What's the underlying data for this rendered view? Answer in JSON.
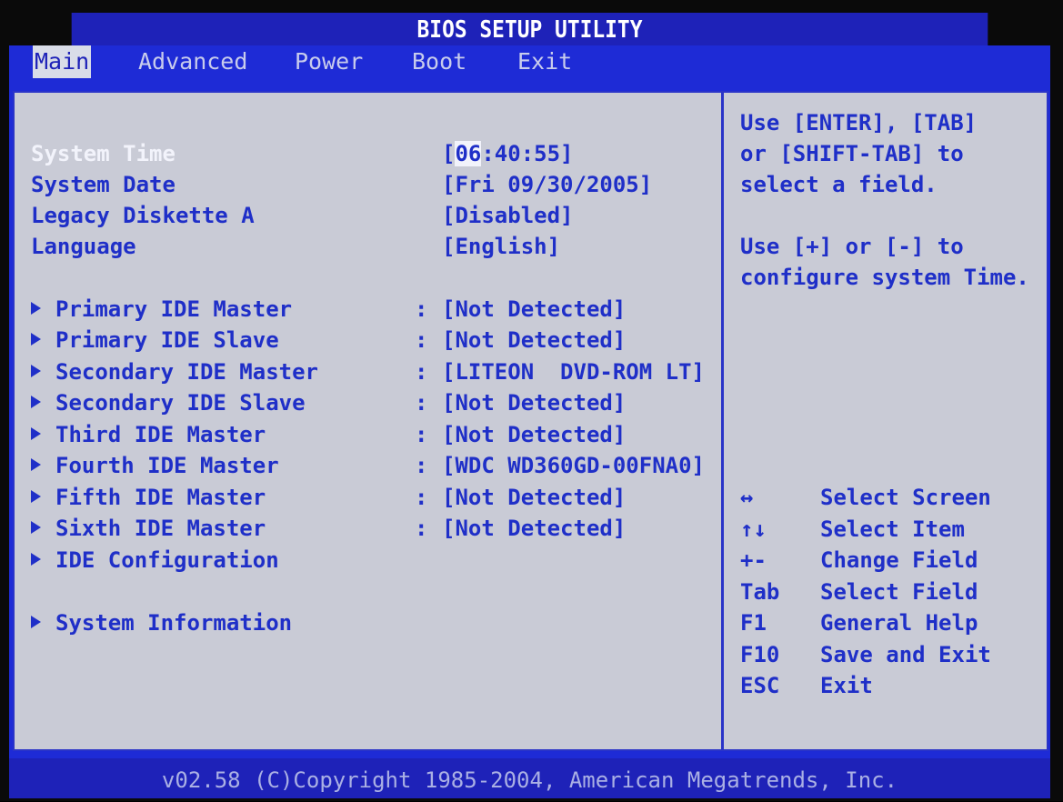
{
  "window": {
    "title": "BIOS SETUP UTILITY"
  },
  "menu": [
    {
      "label": "Main",
      "active": true
    },
    {
      "label": "Advanced",
      "active": false
    },
    {
      "label": "Power",
      "active": false
    },
    {
      "label": "Boot",
      "active": false
    },
    {
      "label": "Exit",
      "active": false
    }
  ],
  "settings": {
    "system_time": {
      "label": "System Time",
      "value_prefix": "[",
      "value_cursor": "06",
      "value_rest": ":40:55]"
    },
    "system_date": {
      "label": "System Date",
      "value": "[Fri 09/30/2005]"
    },
    "legacy_diskette": {
      "label": "Legacy Diskette A",
      "value": "[Disabled]"
    },
    "language": {
      "label": "Language",
      "value": "[English]"
    }
  },
  "devices": [
    {
      "label": "Primary IDE Master",
      "value": "[Not Detected]"
    },
    {
      "label": "Primary IDE Slave",
      "value": "[Not Detected]"
    },
    {
      "label": "Secondary IDE Master",
      "value": "[LITEON  DVD-ROM LT]"
    },
    {
      "label": "Secondary IDE Slave",
      "value": "[Not Detected]"
    },
    {
      "label": "Third IDE Master",
      "value": "[Not Detected]"
    },
    {
      "label": "Fourth IDE Master",
      "value": "[WDC WD360GD-00FNA0]"
    },
    {
      "label": "Fifth IDE Master",
      "value": "[Not Detected]"
    },
    {
      "label": "Sixth IDE Master",
      "value": "[Not Detected]"
    }
  ],
  "submenus": {
    "ide_configuration": "IDE Configuration",
    "system_information": "System Information"
  },
  "colon": ":",
  "help": {
    "lines": [
      "Use [ENTER], [TAB]",
      "or [SHIFT-TAB] to",
      "select a field.",
      "",
      "Use [+] or [-] to",
      "configure system Time."
    ]
  },
  "keys": [
    {
      "key": "↔",
      "desc": "Select Screen"
    },
    {
      "key": "↑↓",
      "desc": "Select Item"
    },
    {
      "key": "+-",
      "desc": "Change Field"
    },
    {
      "key": "Tab",
      "desc": "Select Field"
    },
    {
      "key": "F1",
      "desc": "General Help"
    },
    {
      "key": "F10",
      "desc": "Save and Exit"
    },
    {
      "key": "ESC",
      "desc": "Exit"
    }
  ],
  "footer": {
    "text": "v02.58 (C)Copyright 1985-2004, American Megatrends, Inc."
  },
  "colors": {
    "bios_blue": "#1e2bd6",
    "panel_gray": "#c9cbd6",
    "text_blue": "#1f2fc8",
    "highlight_white": "#f2f3fb"
  }
}
